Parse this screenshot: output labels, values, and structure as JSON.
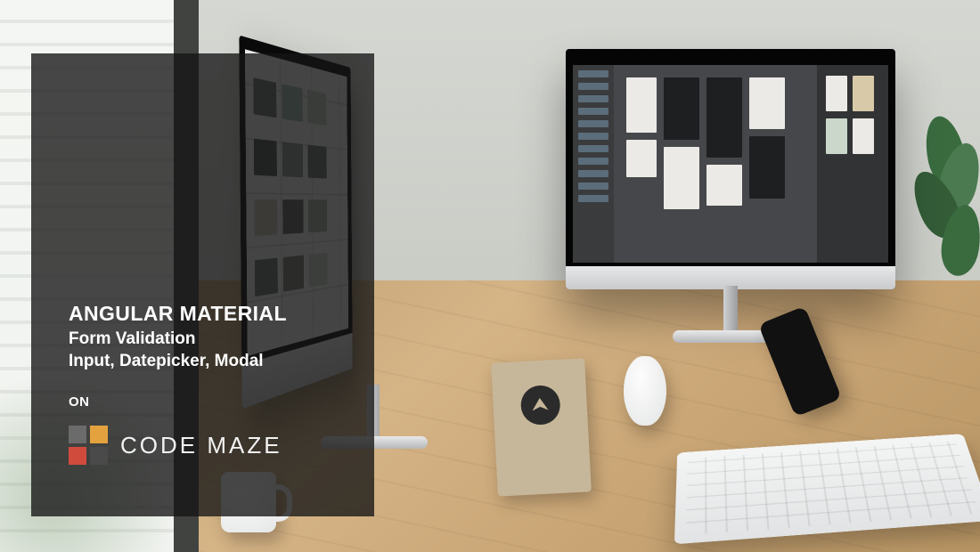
{
  "overlay": {
    "heading": "ANGULAR MATERIAL",
    "subheading1": "Form Validation",
    "subheading2": "Input, Datepicker, Modal",
    "on_label": "ON",
    "brand_text": "CODE MAZE"
  },
  "brand_colors": {
    "tl": "#6b6b6b",
    "tr": "#e4a23f",
    "bl": "#d14b3d",
    "br": "#4a4a4a"
  }
}
